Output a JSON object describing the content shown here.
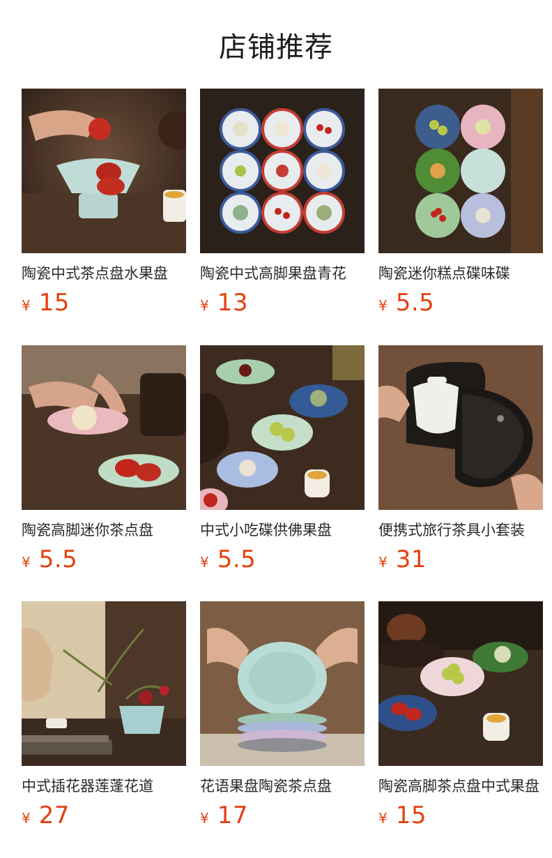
{
  "header": {
    "title": "店铺推荐"
  },
  "currency_symbol": "¥",
  "colors": {
    "price": "#e4400f",
    "title": "#1b1b1b",
    "text": "#2a2a2a"
  },
  "products": [
    {
      "name": "陶瓷中式茶点盘水果盘",
      "price": "15",
      "image": "celadon-footed-fruit-plate-with-tomatoes"
    },
    {
      "name": "陶瓷中式高脚果盘青花",
      "price": "13",
      "image": "nine-blue-and-white-saucers"
    },
    {
      "name": "陶瓷迷你糕点碟味碟",
      "price": "5.5",
      "image": "six-colored-flower-dishes"
    },
    {
      "name": "陶瓷高脚迷你茶点盘",
      "price": "5.5",
      "image": "hands-holding-pink-plate"
    },
    {
      "name": "中式小吃碟供佛果盘",
      "price": "5.5",
      "image": "flower-dishes-on-wood-table"
    },
    {
      "name": "便携式旅行茶具小套装",
      "price": "31",
      "image": "travel-tea-set-case"
    },
    {
      "name": "中式插花器莲蓬花道",
      "price": "27",
      "image": "flower-arrangement-vase"
    },
    {
      "name": "花语果盘陶瓷茶点盘",
      "price": "17",
      "image": "stacked-celadon-plates"
    },
    {
      "name": "陶瓷高脚茶点盘中式果盘",
      "price": "15",
      "image": "footed-dishes-with-teapot"
    }
  ]
}
